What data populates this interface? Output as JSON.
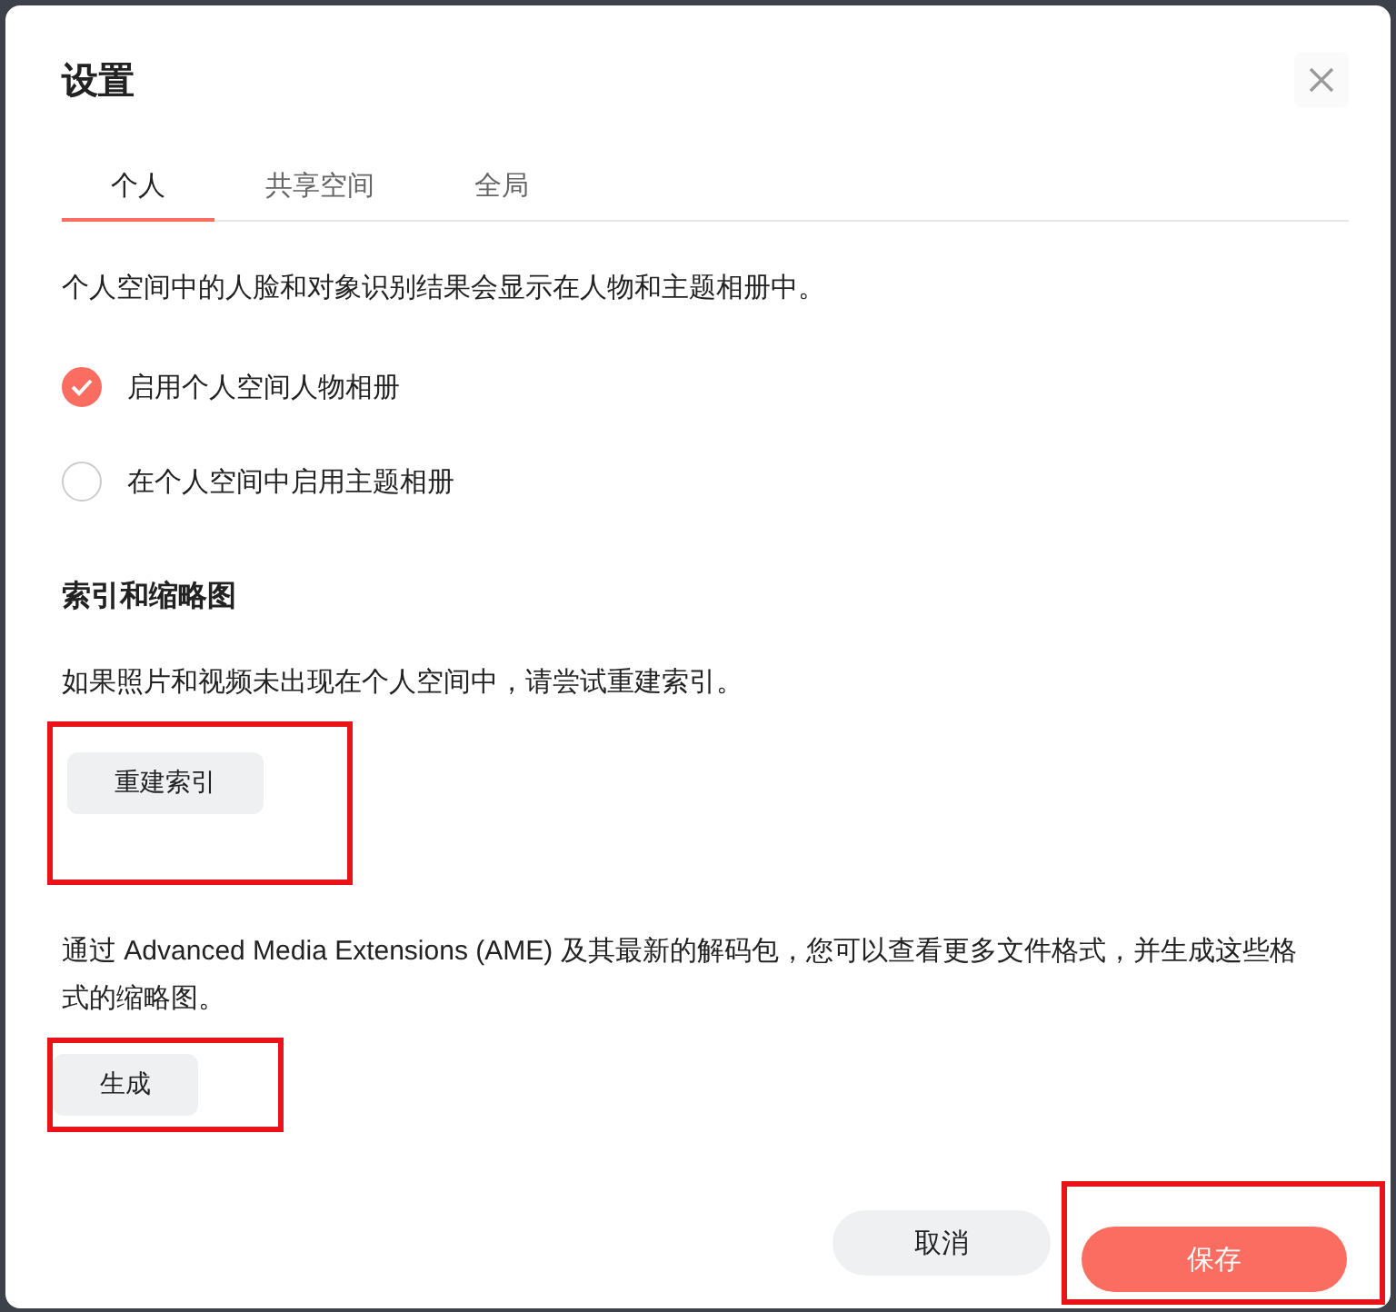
{
  "dialog": {
    "title": "设置"
  },
  "tabs": [
    {
      "label": "个人",
      "selected": true
    },
    {
      "label": "共享空间",
      "selected": false
    },
    {
      "label": "全局",
      "selected": false
    }
  ],
  "description": "个人空间中的人脸和对象识别结果会显示在人物和主题相册中。",
  "options": [
    {
      "label": "启用个人空间人物相册",
      "checked": true
    },
    {
      "label": "在个人空间中启用主题相册",
      "checked": false
    }
  ],
  "section": {
    "heading": "索引和缩略图",
    "items": [
      {
        "text": "如果照片和视频未出现在个人空间中，请尝试重建索引。",
        "button": {
          "label": "重建索引",
          "highlighted": true
        }
      },
      {
        "text": "通过 Advanced Media Extensions (AME) 及其最新的解码包，您可以查看更多文件格式，并生成这些格式的缩略图。",
        "button": {
          "label": "生成",
          "highlighted": true
        }
      }
    ]
  },
  "footer": {
    "buttons": [
      {
        "label": "取消",
        "kind": "secondary",
        "highlighted": false
      },
      {
        "label": "保存",
        "kind": "primary",
        "highlighted": true
      }
    ]
  }
}
